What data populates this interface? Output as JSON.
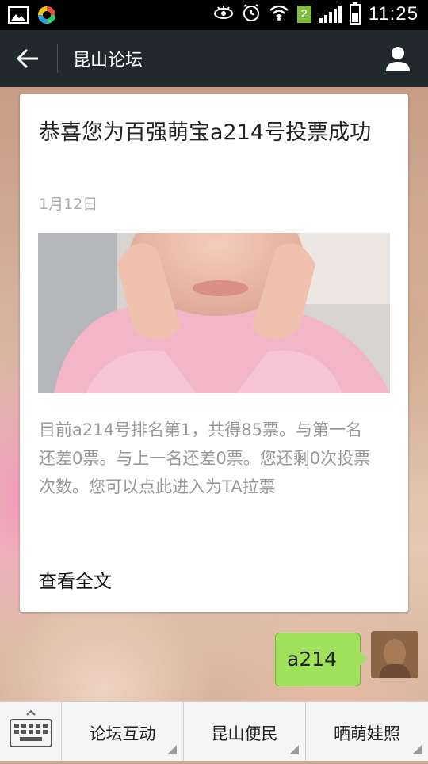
{
  "status_bar": {
    "time": "11:25",
    "sim_badge": "2",
    "icons": [
      "gallery-icon",
      "app-icon",
      "eye-icon",
      "alarm-icon",
      "wifi-icon",
      "signal-icon",
      "battery-icon"
    ]
  },
  "header": {
    "title": "昆山论坛",
    "back_icon": "arrow-left-icon",
    "profile_icon": "person-icon"
  },
  "article": {
    "title": "恭喜您为百强萌宝a214号投票成功",
    "date": "1月12日",
    "description": "目前a214号排名第1，共得85票。与第一名还差0票。与上一名还差0票。您还剩0次投票次数。您可以点此进入为TA拉票",
    "read_more": "查看全文"
  },
  "message": {
    "text": "a214"
  },
  "menu": {
    "keyboard_icon": "keyboard-icon",
    "items": [
      {
        "label": "论坛互动"
      },
      {
        "label": "昆山便民"
      },
      {
        "label": "晒萌娃照"
      }
    ]
  },
  "colors": {
    "header_bg": "#22292c",
    "bubble_green": "#9fe15a",
    "menu_bg": "#f5f5f5"
  }
}
